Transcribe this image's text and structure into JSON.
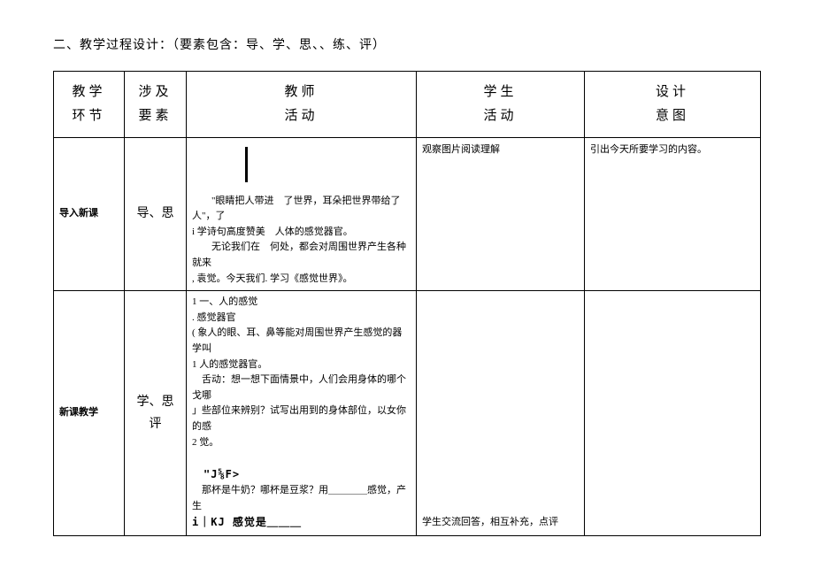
{
  "title": "二、教学过程设计：（要素包含：导、学、思、、练、评）",
  "header": {
    "phase1": "教学",
    "phase2": "环节",
    "element1": "涉及",
    "element2": "要素",
    "teacher1": "教师",
    "teacher2": "活动",
    "student1": "学生",
    "student2": "活动",
    "intent1": "设计",
    "intent2": "意图"
  },
  "rows": [
    {
      "phase": "导入新课",
      "element": "导、思",
      "teacher_lines": [
        "　　\"眼睛把人带进　了世界，耳朵把世界带给了人\"，了",
        "i 学诗句高度赞美　人体的感觉器官。",
        "　　无论我们在　何处，都会对周围世界产生各种就来",
        ", 袁觉。今天我们. 学习《感觉世界》。"
      ],
      "student": "观察图片阅读理解",
      "intent": "引出今天所要学习的内容。"
    },
    {
      "phase": "新课教学",
      "element": "学、思\n评",
      "teacher_lines": [
        "1 一、人的感觉",
        ". 感觉器官",
        "( 象人的眼、耳、鼻等能对周围世界产生感觉的器学叫",
        "1 人的感觉器官。",
        "　舌动：想一想下面情景中，人们会用身体的哪个戈哪",
        "」些部位来辨别？试写出用到的身体部位，以女你的感",
        "2 觉。",
        "",
        "　\"J⅝F>",
        "　那杯是牛奶？哪杯是豆浆？用＿＿＿＿感觉，产生",
        "i｜KJ 感觉是＿＿＿"
      ],
      "student": "学生交流回答，相互补充，点评",
      "intent": ""
    }
  ]
}
